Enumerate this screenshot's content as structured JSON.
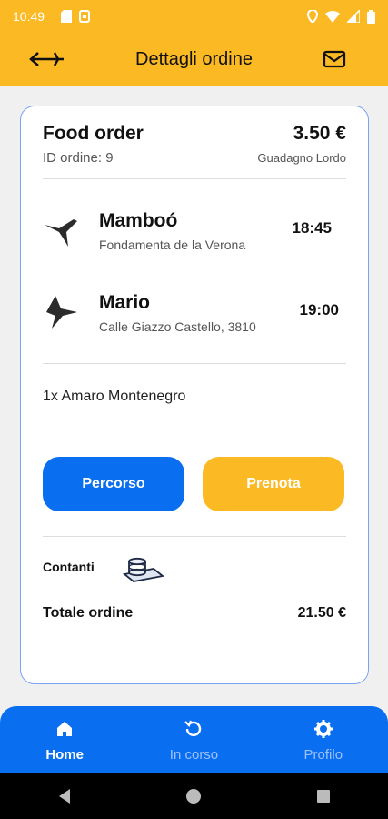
{
  "status_bar": {
    "time": "10:49"
  },
  "app_bar": {
    "title": "Dettagli ordine"
  },
  "order": {
    "type": "Food order",
    "amount": "3.50 €",
    "id_label": "ID ordine: 9",
    "gross_label": "Guadagno Lordo"
  },
  "pickup": {
    "name": "Mamboó",
    "address": "Fondamenta de la Verona",
    "time": "18:45"
  },
  "dropoff": {
    "name": "Mario",
    "address": "Calle Giazzo Castello, 3810",
    "time": "19:00"
  },
  "items": "1x Amaro Montenegro",
  "buttons": {
    "route": "Percorso",
    "book": "Prenota"
  },
  "payment": {
    "method": "Contanti"
  },
  "total": {
    "label": "Totale ordine",
    "value": "21.50 €"
  },
  "bottom_nav": {
    "home": "Home",
    "in_progress": "In corso",
    "profile": "Profilo"
  },
  "colors": {
    "accent_yellow": "#fbb923",
    "accent_blue": "#0a6ef0"
  }
}
